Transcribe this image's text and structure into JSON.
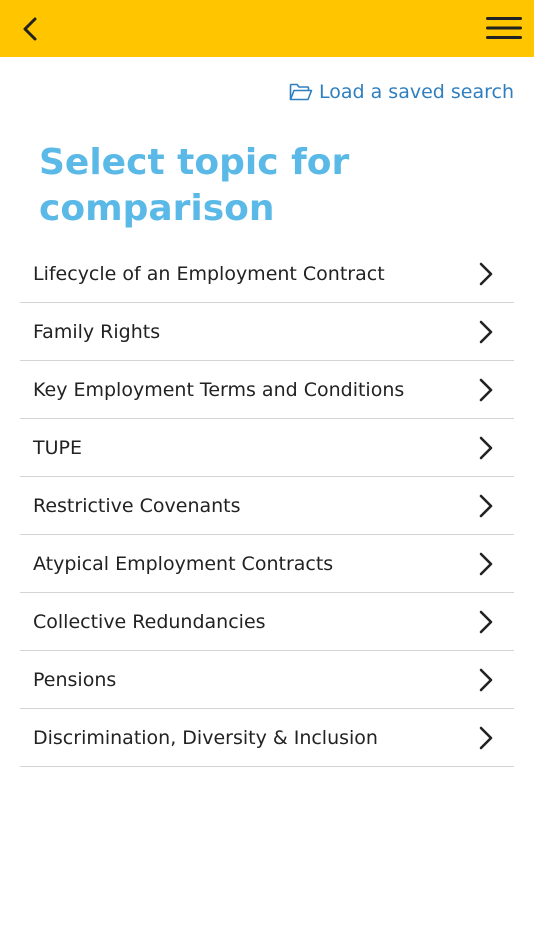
{
  "header": {
    "back_icon": "chevron-left-icon",
    "menu_icon": "hamburger-menu-icon",
    "background_color": "#ffc600"
  },
  "load_search": {
    "icon": "folder-open-icon",
    "label": "Load a saved search",
    "color": "#2f7fbf"
  },
  "page": {
    "title": "Select topic for comparison",
    "title_color": "#5ab9e6"
  },
  "topics": [
    {
      "label": "Lifecycle of an Employment Contract"
    },
    {
      "label": "Family Rights"
    },
    {
      "label": "Key Employment Terms and Conditions"
    },
    {
      "label": "TUPE"
    },
    {
      "label": "Restrictive Covenants"
    },
    {
      "label": "Atypical Employment Contracts"
    },
    {
      "label": "Collective Redundancies"
    },
    {
      "label": "Pensions"
    },
    {
      "label": "Discrimination, Diversity & Inclusion"
    }
  ]
}
